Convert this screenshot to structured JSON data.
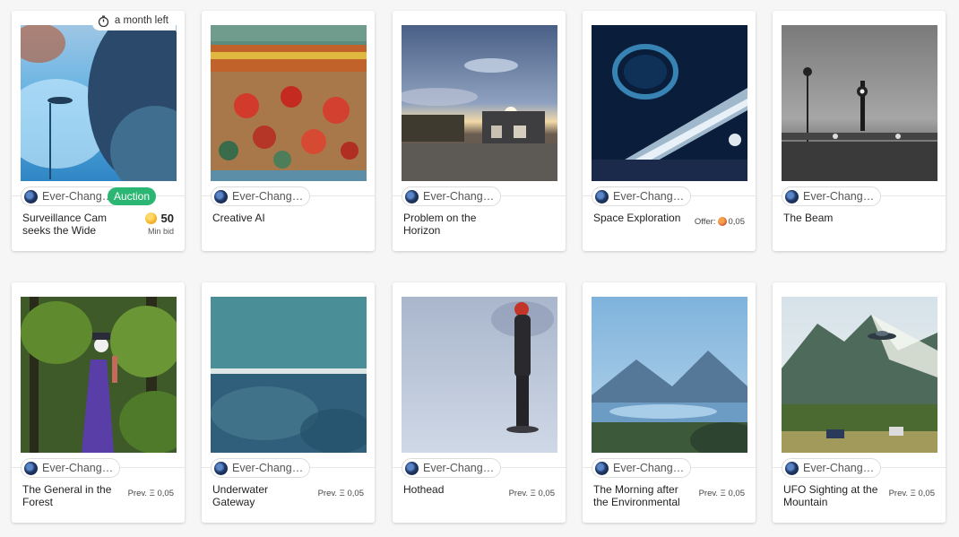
{
  "cards": [
    {
      "title": "Surveillance Cam seeks the Wide",
      "creator": "Ever-Chang…",
      "status": "Auction",
      "timer": "a month left",
      "price": "50",
      "price_label": "Min bid"
    },
    {
      "title": "Creative AI",
      "creator": "Ever-Chang…"
    },
    {
      "title": "Problem on the Horizon",
      "creator": "Ever-Chang…"
    },
    {
      "title": "Space Exploration",
      "creator": "Ever-Chang…",
      "offer_label": "Offer:",
      "offer_value": "0,05"
    },
    {
      "title": "The Beam",
      "creator": "Ever-Chang…"
    },
    {
      "title": "The General in the Forest",
      "creator": "Ever-Chang…",
      "prev": "Prev. Ξ 0,05"
    },
    {
      "title": "Underwater Gateway",
      "creator": "Ever-Chang…",
      "prev": "Prev. Ξ 0,05"
    },
    {
      "title": "Hothead",
      "creator": "Ever-Chang…",
      "prev": "Prev. Ξ 0,05"
    },
    {
      "title": "The Morning after the Environmental",
      "creator": "Ever-Chang…",
      "prev": "Prev. Ξ 0,05"
    },
    {
      "title": "UFO Sighting at the Mountain",
      "creator": "Ever-Chang…",
      "prev": "Prev. Ξ 0,05"
    }
  ],
  "colors": {
    "auction_badge": "#2bb673",
    "card": "#ffffff",
    "background": "#f6f6f6"
  }
}
